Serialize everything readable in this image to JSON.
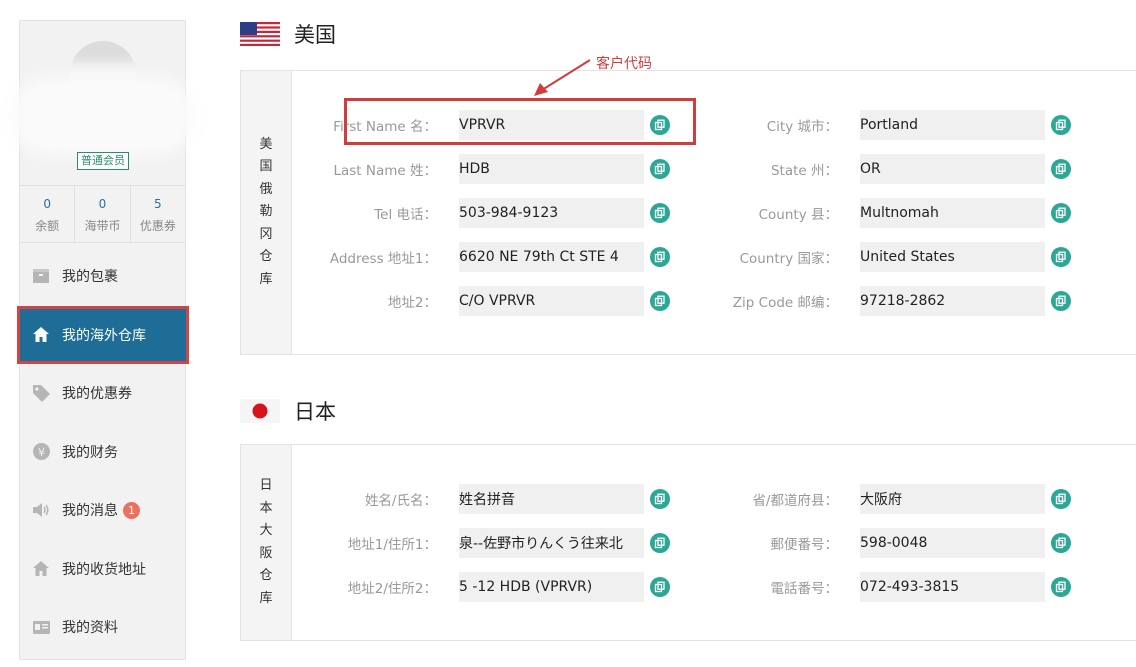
{
  "sidebar": {
    "member_badge": "普通会员",
    "stats": [
      {
        "num": "0",
        "label": "余额"
      },
      {
        "num": "0",
        "label": "海带币"
      },
      {
        "num": "5",
        "label": "优惠券"
      }
    ],
    "items": [
      {
        "label": "我的包裹",
        "icon": "package-icon"
      },
      {
        "label": "我的海外仓库",
        "icon": "home-icon",
        "active": true
      },
      {
        "label": "我的优惠券",
        "icon": "tag-icon"
      },
      {
        "label": "我的财务",
        "icon": "yen-icon"
      },
      {
        "label": "我的消息",
        "icon": "speaker-icon",
        "badge": "1"
      },
      {
        "label": "我的收货地址",
        "icon": "house-icon"
      },
      {
        "label": "我的资料",
        "icon": "id-card-icon"
      }
    ]
  },
  "annotation": {
    "text": "客户代码",
    "color": "#d13c3c"
  },
  "usa": {
    "country": "美国",
    "warehouse": [
      "美",
      "国",
      "俄",
      "勒",
      "冈",
      "仓",
      "库"
    ],
    "left": [
      {
        "label": "First Name 名：",
        "value": "VPRVR"
      },
      {
        "label": "Last Name 姓：",
        "value": "HDB"
      },
      {
        "label": "Tel 电话：",
        "value": "503-984-9123"
      },
      {
        "label": "Address 地址1：",
        "value": "6620 NE 79th Ct STE 4"
      },
      {
        "label": "地址2：",
        "value": "C/O VPRVR"
      }
    ],
    "right": [
      {
        "label": "City 城市：",
        "value": "Portland"
      },
      {
        "label": "State 州：",
        "value": "OR"
      },
      {
        "label": "County 县：",
        "value": "Multnomah"
      },
      {
        "label": "Country 国家：",
        "value": "United States"
      },
      {
        "label": "Zip Code 邮编：",
        "value": "97218-2862"
      }
    ]
  },
  "japan": {
    "country": "日本",
    "warehouse": [
      "日",
      "本",
      "大",
      "阪",
      "仓",
      "库"
    ],
    "left": [
      {
        "label": "姓名/氏名：",
        "value": "姓名拼音"
      },
      {
        "label": "地址1/住所1：",
        "value": "泉--佐野市りんくう往来北"
      },
      {
        "label": "地址2/住所2：",
        "value": "5 -12 HDB (VPRVR)"
      }
    ],
    "right": [
      {
        "label": "省/都道府县：",
        "value": "大阪府"
      },
      {
        "label": "郵便番号：",
        "value": "598-0048"
      },
      {
        "label": "電話番号：",
        "value": "072-493-3815"
      }
    ]
  },
  "colors": {
    "accent": "#1d6d96",
    "copy": "#2aa796",
    "highlight": "#d13c3c"
  }
}
